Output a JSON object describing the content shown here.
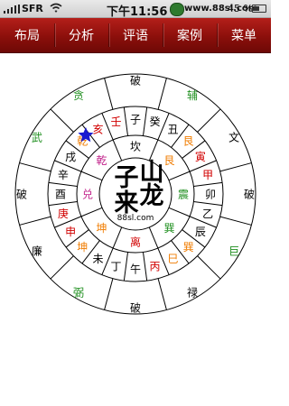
{
  "status_bar": {
    "carrier": "SFR",
    "time": "下午11:56",
    "watermark": "www.88sl.com",
    "battery": "45 %"
  },
  "tabs": [
    "布局",
    "分析",
    "评语",
    "案例",
    "菜单"
  ],
  "colors": {
    "tab_bar": "#8b0f0b",
    "ink": "#000000",
    "red": "#d10000",
    "orange": "#f07c00",
    "green": "#1f8f1f",
    "magenta": "#c1208a",
    "blue": "#1a1ad0"
  },
  "compass": {
    "center_title": [
      "子",
      "山",
      "来",
      "龙"
    ],
    "center_url": "88sl.com",
    "star_icon": "star-icon",
    "bagua": [
      {
        "text": "坎",
        "color": "ink"
      },
      {
        "text": "艮",
        "color": "orange"
      },
      {
        "text": "震",
        "color": "green"
      },
      {
        "text": "巽",
        "color": "green"
      },
      {
        "text": "离",
        "color": "red"
      },
      {
        "text": "坤",
        "color": "orange"
      },
      {
        "text": "兑",
        "color": "magenta"
      },
      {
        "text": "乾",
        "color": "magenta"
      }
    ],
    "mountains": [
      {
        "text": "子",
        "color": "ink"
      },
      {
        "text": "癸",
        "color": "ink"
      },
      {
        "text": "丑",
        "color": "ink"
      },
      {
        "text": "艮",
        "color": "orange"
      },
      {
        "text": "寅",
        "color": "red"
      },
      {
        "text": "甲",
        "color": "red"
      },
      {
        "text": "卯",
        "color": "ink"
      },
      {
        "text": "乙",
        "color": "ink"
      },
      {
        "text": "辰",
        "color": "ink"
      },
      {
        "text": "巽",
        "color": "orange"
      },
      {
        "text": "巳",
        "color": "orange"
      },
      {
        "text": "丙",
        "color": "red"
      },
      {
        "text": "午",
        "color": "ink"
      },
      {
        "text": "丁",
        "color": "ink"
      },
      {
        "text": "未",
        "color": "ink"
      },
      {
        "text": "坤",
        "color": "orange"
      },
      {
        "text": "申",
        "color": "red"
      },
      {
        "text": "庚",
        "color": "red"
      },
      {
        "text": "酉",
        "color": "ink"
      },
      {
        "text": "辛",
        "color": "ink"
      },
      {
        "text": "戌",
        "color": "ink"
      },
      {
        "text": "乾",
        "color": "orange"
      },
      {
        "text": "亥",
        "color": "red"
      },
      {
        "text": "壬",
        "color": "red"
      }
    ],
    "stars": [
      {
        "text": "破",
        "color": "ink"
      },
      {
        "text": "辅",
        "color": "green"
      },
      {
        "text": "文",
        "color": "ink"
      },
      {
        "text": "破",
        "color": "ink"
      },
      {
        "text": "巨",
        "color": "green"
      },
      {
        "text": "禄",
        "color": "ink"
      },
      {
        "text": "破",
        "color": "ink"
      },
      {
        "text": "弼",
        "color": "green"
      },
      {
        "text": "廉",
        "color": "ink"
      },
      {
        "text": "破",
        "color": "ink"
      },
      {
        "text": "武",
        "color": "green"
      },
      {
        "text": "贪",
        "color": "green"
      }
    ]
  }
}
